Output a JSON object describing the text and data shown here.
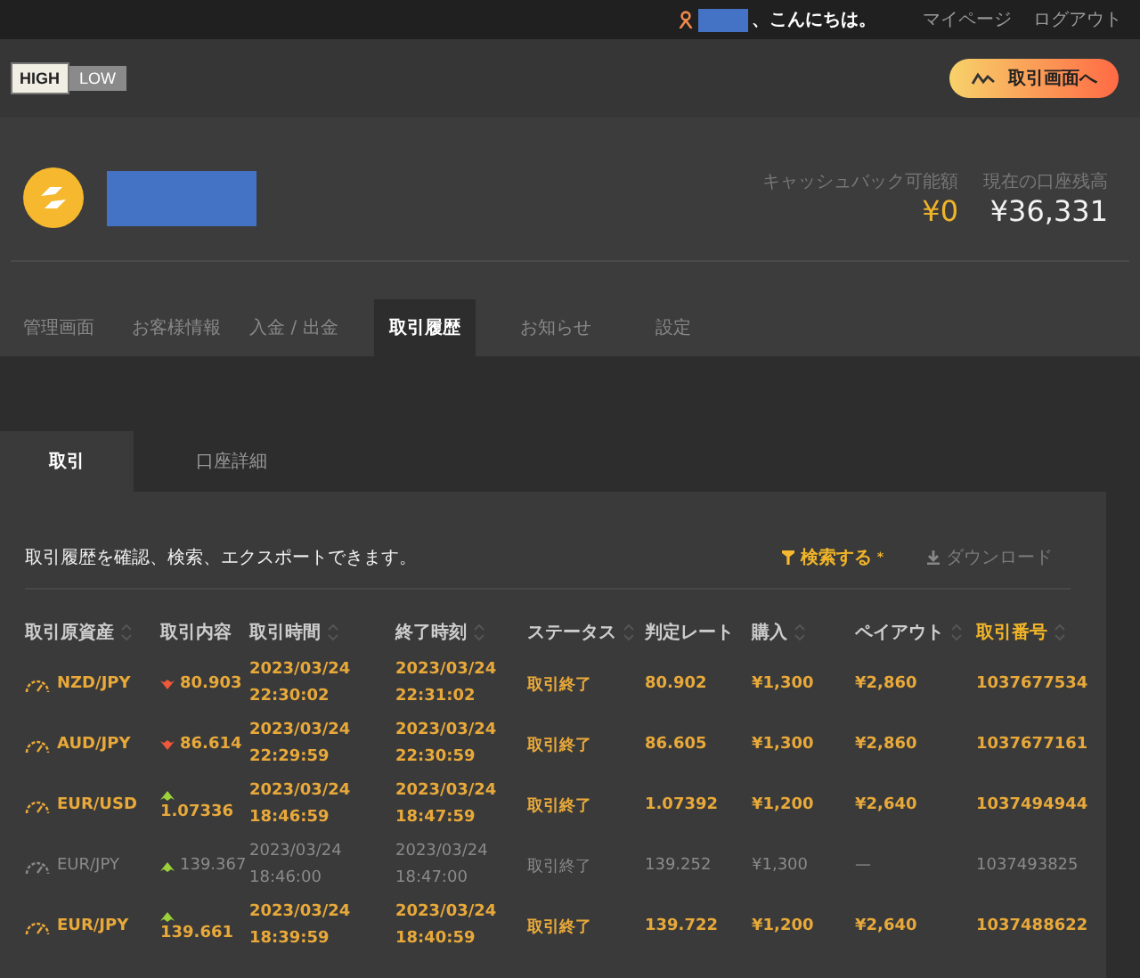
{
  "top_bar": {
    "greeting": "、こんにちは。",
    "links": [
      "マイページ",
      "ログアウト"
    ]
  },
  "header": {
    "logo": [
      "HIGH",
      "LOW"
    ],
    "trade_button": "取引画面へ"
  },
  "account": {
    "balances": [
      {
        "label": "キャッシュバック可能額",
        "value": "¥0",
        "kind": "cashback"
      },
      {
        "label": "現在の口座残高",
        "value": "¥36,331",
        "kind": "balance"
      }
    ]
  },
  "nav_tabs": [
    {
      "label": "管理画面",
      "selected": false
    },
    {
      "label": "お客様情報",
      "selected": false
    },
    {
      "label": "入金 / 出金",
      "selected": false
    },
    {
      "label": "取引履歴",
      "selected": true
    },
    {
      "label": "お知らせ",
      "selected": false
    },
    {
      "label": "設定",
      "selected": false
    }
  ],
  "sub_tabs": [
    {
      "label": "取引",
      "selected": true
    },
    {
      "label": "口座詳細",
      "selected": false
    }
  ],
  "panel": {
    "description": "取引履歴を確認、検索、エクスポートできます。",
    "search": "検索する",
    "search_mark": "*",
    "download": {
      "label": "ダウンロード",
      "disabled": true
    }
  },
  "table": {
    "columns": [
      {
        "label": "取引原資産",
        "sortable": true,
        "selected": false
      },
      {
        "label": "取引内容",
        "sortable": false,
        "selected": false
      },
      {
        "label": "取引時間",
        "sortable": true,
        "selected": false
      },
      {
        "label": "終了時刻",
        "sortable": true,
        "selected": false
      },
      {
        "label": "ステータス",
        "sortable": true,
        "selected": false
      },
      {
        "label": "判定レート",
        "sortable": false,
        "selected": false
      },
      {
        "label": "購入",
        "sortable": true,
        "selected": false
      },
      {
        "label": "ペイアウト",
        "sortable": true,
        "selected": false
      },
      {
        "label": "取引番号",
        "sortable": true,
        "selected": true
      }
    ],
    "rows": [
      {
        "asset": "NZD/JPY",
        "kind": "down",
        "strike": "80.903",
        "open": "2023/03/24 22:30:02",
        "close": "2023/03/24 22:31:02",
        "status": "取引終了",
        "rate": "80.902",
        "stake": "¥1,300",
        "payout": "¥2,860",
        "id": "1037677534",
        "won": true
      },
      {
        "asset": "AUD/JPY",
        "kind": "down",
        "strike": "86.614",
        "open": "2023/03/24 22:29:59",
        "close": "2023/03/24 22:30:59",
        "status": "取引終了",
        "rate": "86.605",
        "stake": "¥1,300",
        "payout": "¥2,860",
        "id": "1037677161",
        "won": true
      },
      {
        "asset": "EUR/USD",
        "kind": "up",
        "strike": "1.07336",
        "open": "2023/03/24 18:46:59",
        "close": "2023/03/24 18:47:59",
        "status": "取引終了",
        "rate": "1.07392",
        "stake": "¥1,200",
        "payout": "¥2,640",
        "id": "1037494944",
        "won": true
      },
      {
        "asset": "EUR/JPY",
        "kind": "up",
        "strike": "139.367",
        "open": "2023/03/24 18:46:00",
        "close": "2023/03/24 18:47:00",
        "status": "取引終了",
        "rate": "139.252",
        "stake": "¥1,300",
        "payout": "—",
        "id": "1037493825",
        "won": false
      },
      {
        "asset": "EUR/JPY",
        "kind": "up",
        "strike": "139.661",
        "open": "2023/03/24 18:39:59",
        "close": "2023/03/24 18:40:59",
        "status": "取引終了",
        "rate": "139.722",
        "stake": "¥1,200",
        "payout": "¥2,640",
        "id": "1037488622",
        "won": true
      }
    ]
  }
}
